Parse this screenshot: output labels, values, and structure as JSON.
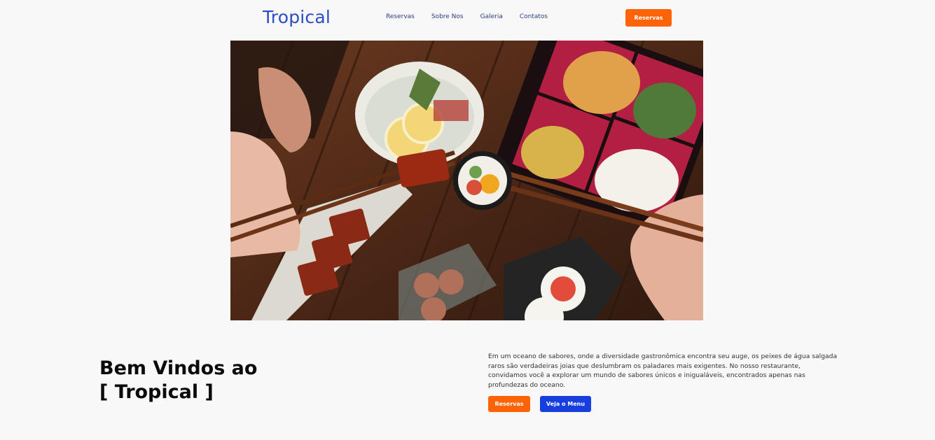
{
  "header": {
    "logo": "Tropical",
    "nav": [
      "Reservas",
      "Sobre Nos",
      "Galeria",
      "Contatos"
    ],
    "cta": "Reservas"
  },
  "hero": {
    "icon": "sushi-photo"
  },
  "intro": {
    "title_line1": "Bem Vindos ao",
    "title_line2": "[ Tropical ]",
    "description": "Em um oceano de sabores, onde a diversidade gastronômica encontra seu auge, os peixes de água salgada raros são verdadeiras joias que deslumbram os paladares mais exigentes. No nosso restaurante, convidamos você a explorar um mundo de sabores únicos e inigualáveis, encontrados apenas nas profundezas do oceano.",
    "reservas_button": "Reservas",
    "menu_button": "Veja o Menu"
  },
  "colors": {
    "accent_orange": "#ff6308",
    "accent_blue": "#173fe0",
    "logo_blue": "#2a4dc5",
    "background": "#f8f8f8"
  }
}
